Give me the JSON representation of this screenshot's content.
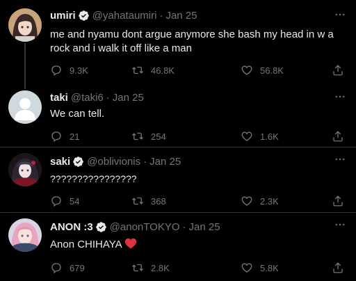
{
  "colors": {
    "background": "#000000",
    "text": "#e7e9ea",
    "muted": "#71767b",
    "verified": "#1d9bf0",
    "heart": "#f91880"
  },
  "tweets": [
    {
      "name": "umiri",
      "handle": "@yahataumiri",
      "separator": "·",
      "date": "Jan 25",
      "text": "me and nyamu dont argue anymore she bash my head in w a rock and i walk it off like a man",
      "replies": "9.3K",
      "retweets": "46.8K",
      "likes": "56.8K"
    },
    {
      "name": "taki",
      "handle": "@taki6",
      "separator": "·",
      "date": "Jan 25",
      "text": "We can tell.",
      "replies": "21",
      "retweets": "254",
      "likes": "1.6K"
    },
    {
      "name": "saki",
      "handle": "@oblivionis",
      "separator": "·",
      "date": "Jan 25",
      "text": "????????????????",
      "replies": "54",
      "retweets": "368",
      "likes": "2.3K"
    },
    {
      "name": "ANON :3",
      "handle": "@anonTOKYO",
      "separator": "·",
      "date": "Jan 25",
      "text": "Anon CHIHAYA",
      "replies": "679",
      "retweets": "2.8K",
      "likes": "5.8K"
    }
  ]
}
